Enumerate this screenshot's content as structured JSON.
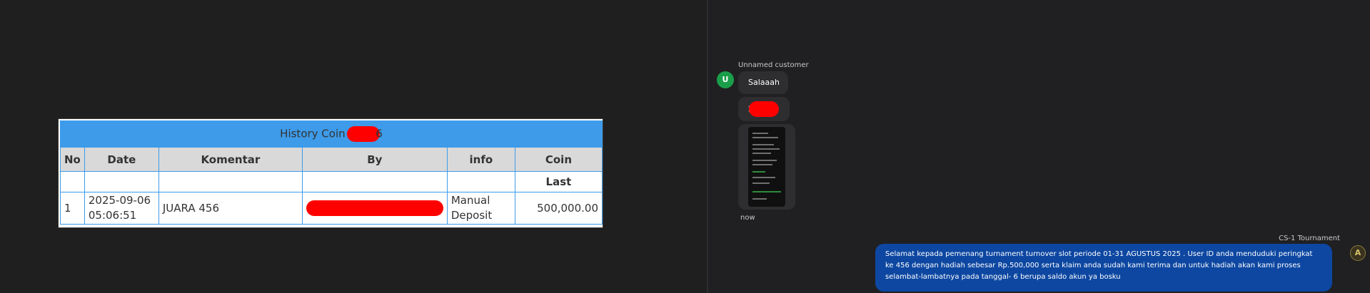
{
  "history": {
    "title_prefix": "History Coin z",
    "title_suffix": "6",
    "columns": [
      "No",
      "Date",
      "Komentar",
      "By",
      "info",
      "Coin"
    ],
    "subheader_last": "Last",
    "rows": [
      {
        "no": "1",
        "date_line1": "2025-09-06",
        "date_line2": "05:06:51",
        "komentar": "JUARA 456",
        "info_line1": "Manual",
        "info_line2": "Deposit",
        "coin": "500,000.00"
      }
    ]
  },
  "chat": {
    "customer_name": "Unnamed customer",
    "customer_avatar_letter": "U",
    "messages_in": [
      {
        "text": "Salaaah"
      },
      {
        "text": "2"
      }
    ],
    "time_now": "now",
    "agent_name": "CS-1 Tournament",
    "agent_avatar_letter": "A",
    "message_out": "Selamat kepada pemenang turnament turnover slot periode 01-31 AGUSTUS 2025 . User ID anda menduduki peringkat ke 456 dengan hadiah sebesar Rp.500,000 serta klaim anda sudah kami terima dan untuk hadiah akan kami proses selambat-lambatnya pada tanggal- 6 berupa saldo akun ya bosku"
  },
  "colors": {
    "table_header_blue": "#3d9be9",
    "coin_green": "#1b8a1b",
    "redaction_red": "#ff0000",
    "outgoing_bubble": "#0d47a1",
    "avatar_green": "#1a9e4a"
  }
}
